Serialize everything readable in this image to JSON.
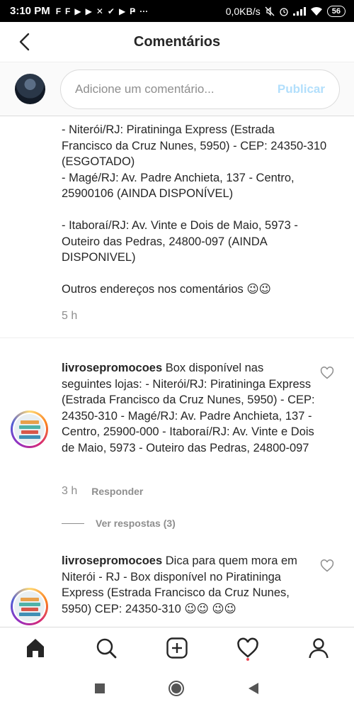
{
  "status_bar": {
    "time": "3:10 PM",
    "icons": [
      "F",
      "F",
      "▶",
      "▶",
      "✕",
      "✔",
      "▶",
      "Ҏ"
    ],
    "dots": "···",
    "speed": "0,0KB/s",
    "battery": "56"
  },
  "header": {
    "title": "Comentários"
  },
  "compose": {
    "placeholder": "Adicione um comentário...",
    "publish_label": "Publicar"
  },
  "post": {
    "text": "- Niterói/RJ: Piratininga Express (Estrada Francisco da Cruz Nunes, 5950) - CEP: 24350-310 (ESGOTADO)\n- Magé/RJ: Av. Padre Anchieta, 137 - Centro, 25900106 (AINDA DISPONÍVEL)\n\n- Itaboraí/RJ: Av. Vinte e Dois de Maio, 5973 - Outeiro das Pedras, 24800-097 (AINDA DISPONIVEL)\n\nOutros endereços nos comentários 😉😉",
    "time": "5 h"
  },
  "comments": [
    {
      "username": "livrosepromocoes",
      "text": "Box disponível nas seguintes lojas: - Niterói/RJ: Piratininga Express (Estrada Francisco da Cruz Nunes, 5950) - CEP: 24350-310 - Magé/RJ: Av. Padre Anchieta, 137 - Centro, 25900-000 - Itaboraí/RJ: Av. Vinte e Dois de Maio, 5973 - Outeiro das Pedras, 24800-097",
      "time": "3 h",
      "reply_label": "Responder",
      "view_replies": "Ver respostas (3)"
    },
    {
      "username": "livrosepromocoes",
      "text": "Dica para quem mora em Niterói - RJ - Box disponível no Piratininga Express (Estrada Francisco da Cruz Nunes, 5950) CEP: 24350-310 😉😉 😉😉"
    }
  ],
  "colors": {
    "accent_disabled": "#b2dffc",
    "secondary_text": "#8e8e8e",
    "notification_dot": "#ed4956"
  }
}
